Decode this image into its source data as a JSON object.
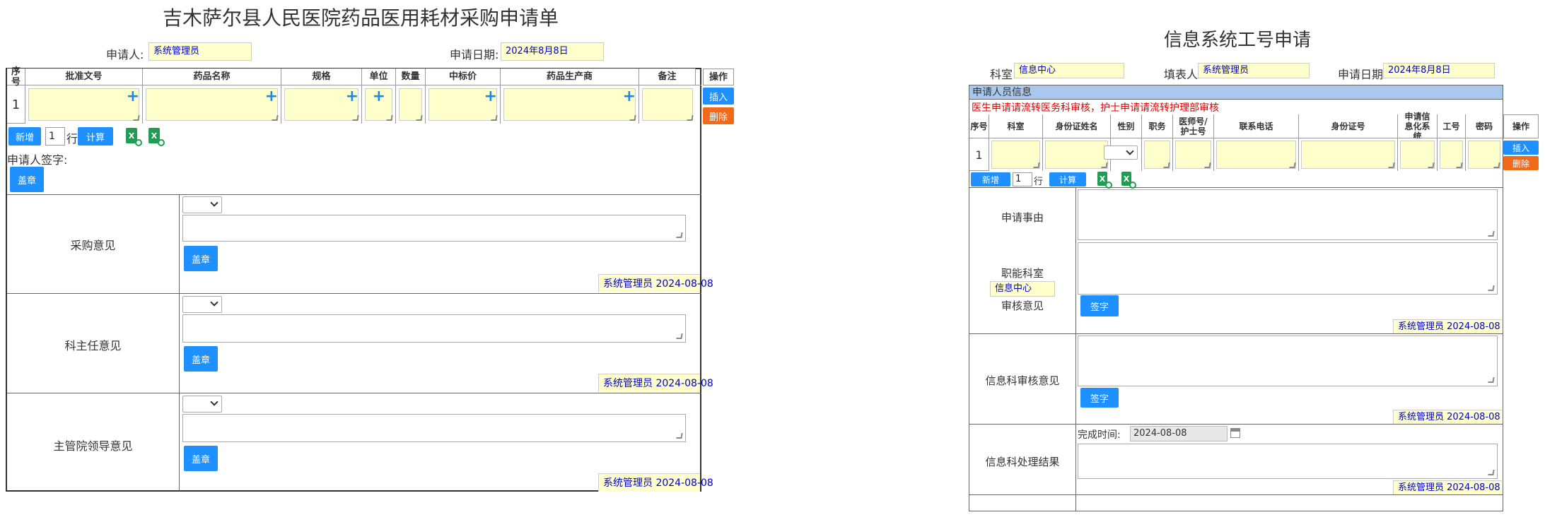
{
  "left": {
    "title": "吉木萨尔县人民医院药品医用耗材采购申请单",
    "applicant_label": "申请人:",
    "applicant_value": "系统管理员",
    "date_label": "申请日期:",
    "date_value": "2024年8月8日",
    "columns": [
      "序号",
      "批准文号",
      "药品名称",
      "规格",
      "单位",
      "数量",
      "中标价",
      "药品生产商",
      "备注",
      "操作"
    ],
    "row_index": "1",
    "insert_label": "插入",
    "delete_label": "删除",
    "add_label": "新增",
    "row_count": "1",
    "row_unit": "行",
    "calc_label": "计算",
    "excel_icon_text": "X",
    "signer_label": "申请人签字:",
    "sign_label": "盖章",
    "sections": [
      {
        "label": "采购意见",
        "signature": "系统管理员 2024-08-08"
      },
      {
        "label": "科主任意见",
        "signature": "系统管理员 2024-08-08"
      },
      {
        "label": "主管院领导意见",
        "signature": "系统管理员 2024-08-08"
      }
    ]
  },
  "right": {
    "title": "信息系统工号申请",
    "dept_label": "科室:",
    "dept_value": "信息中心",
    "filler_label": "填表人:",
    "filler_value": "系统管理员",
    "date_label": "申请日期:",
    "date_value": "2024年8月8日",
    "section_header": "申请人员信息",
    "notice": "医生申请请流转医务科审核，护士申请请流转护理部审核",
    "columns": [
      "序号",
      "科室",
      "身份证姓名",
      "性别",
      "职务",
      "医师号/护士号",
      "联系电话",
      "身份证号",
      "申请信息化系统",
      "工号",
      "密码",
      "操作"
    ],
    "row_index": "1",
    "insert_label": "插入",
    "delete_label": "删除",
    "add_label": "新增",
    "row_count": "1",
    "row_unit": "行",
    "calc_label": "计算",
    "excel_icon_text": "X",
    "reason_label": "申请事由",
    "dept_review_label_1": "职能科室",
    "dept_review_value": "信息中心",
    "dept_review_label_2": "审核意见",
    "sign_label": "签字",
    "dept_review_signature": "系统管理员 2024-08-08",
    "info_review_label": "信息科审核意见",
    "info_review_signature": "系统管理员 2024-08-08",
    "finish_time_label": "完成时间:",
    "finish_time_value": "2024-08-08",
    "result_label": "信息科处理结果",
    "result_signature": "系统管理员 2024-08-08"
  }
}
